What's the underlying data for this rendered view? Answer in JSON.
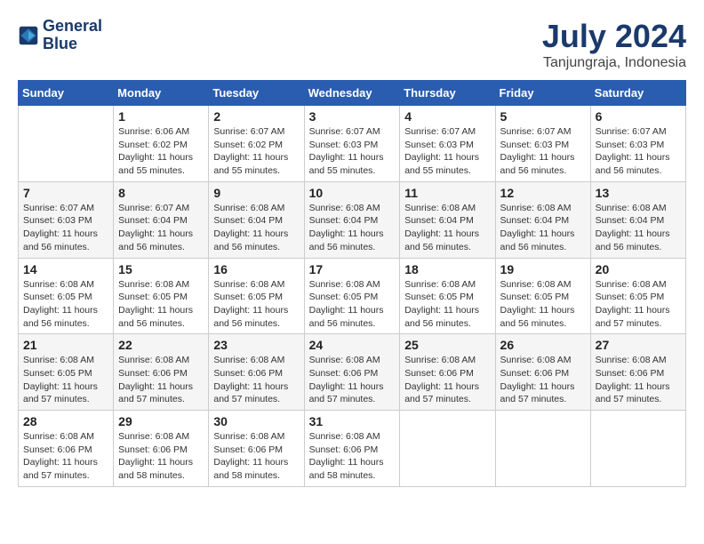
{
  "header": {
    "logo_line1": "General",
    "logo_line2": "Blue",
    "month_year": "July 2024",
    "location": "Tanjungraja, Indonesia"
  },
  "weekdays": [
    "Sunday",
    "Monday",
    "Tuesday",
    "Wednesday",
    "Thursday",
    "Friday",
    "Saturday"
  ],
  "weeks": [
    [
      {
        "day": "",
        "info": ""
      },
      {
        "day": "1",
        "info": "Sunrise: 6:06 AM\nSunset: 6:02 PM\nDaylight: 11 hours\nand 55 minutes."
      },
      {
        "day": "2",
        "info": "Sunrise: 6:07 AM\nSunset: 6:02 PM\nDaylight: 11 hours\nand 55 minutes."
      },
      {
        "day": "3",
        "info": "Sunrise: 6:07 AM\nSunset: 6:03 PM\nDaylight: 11 hours\nand 55 minutes."
      },
      {
        "day": "4",
        "info": "Sunrise: 6:07 AM\nSunset: 6:03 PM\nDaylight: 11 hours\nand 55 minutes."
      },
      {
        "day": "5",
        "info": "Sunrise: 6:07 AM\nSunset: 6:03 PM\nDaylight: 11 hours\nand 56 minutes."
      },
      {
        "day": "6",
        "info": "Sunrise: 6:07 AM\nSunset: 6:03 PM\nDaylight: 11 hours\nand 56 minutes."
      }
    ],
    [
      {
        "day": "7",
        "info": "Sunrise: 6:07 AM\nSunset: 6:03 PM\nDaylight: 11 hours\nand 56 minutes."
      },
      {
        "day": "8",
        "info": "Sunrise: 6:07 AM\nSunset: 6:04 PM\nDaylight: 11 hours\nand 56 minutes."
      },
      {
        "day": "9",
        "info": "Sunrise: 6:08 AM\nSunset: 6:04 PM\nDaylight: 11 hours\nand 56 minutes."
      },
      {
        "day": "10",
        "info": "Sunrise: 6:08 AM\nSunset: 6:04 PM\nDaylight: 11 hours\nand 56 minutes."
      },
      {
        "day": "11",
        "info": "Sunrise: 6:08 AM\nSunset: 6:04 PM\nDaylight: 11 hours\nand 56 minutes."
      },
      {
        "day": "12",
        "info": "Sunrise: 6:08 AM\nSunset: 6:04 PM\nDaylight: 11 hours\nand 56 minutes."
      },
      {
        "day": "13",
        "info": "Sunrise: 6:08 AM\nSunset: 6:04 PM\nDaylight: 11 hours\nand 56 minutes."
      }
    ],
    [
      {
        "day": "14",
        "info": "Sunrise: 6:08 AM\nSunset: 6:05 PM\nDaylight: 11 hours\nand 56 minutes."
      },
      {
        "day": "15",
        "info": "Sunrise: 6:08 AM\nSunset: 6:05 PM\nDaylight: 11 hours\nand 56 minutes."
      },
      {
        "day": "16",
        "info": "Sunrise: 6:08 AM\nSunset: 6:05 PM\nDaylight: 11 hours\nand 56 minutes."
      },
      {
        "day": "17",
        "info": "Sunrise: 6:08 AM\nSunset: 6:05 PM\nDaylight: 11 hours\nand 56 minutes."
      },
      {
        "day": "18",
        "info": "Sunrise: 6:08 AM\nSunset: 6:05 PM\nDaylight: 11 hours\nand 56 minutes."
      },
      {
        "day": "19",
        "info": "Sunrise: 6:08 AM\nSunset: 6:05 PM\nDaylight: 11 hours\nand 56 minutes."
      },
      {
        "day": "20",
        "info": "Sunrise: 6:08 AM\nSunset: 6:05 PM\nDaylight: 11 hours\nand 57 minutes."
      }
    ],
    [
      {
        "day": "21",
        "info": "Sunrise: 6:08 AM\nSunset: 6:05 PM\nDaylight: 11 hours\nand 57 minutes."
      },
      {
        "day": "22",
        "info": "Sunrise: 6:08 AM\nSunset: 6:06 PM\nDaylight: 11 hours\nand 57 minutes."
      },
      {
        "day": "23",
        "info": "Sunrise: 6:08 AM\nSunset: 6:06 PM\nDaylight: 11 hours\nand 57 minutes."
      },
      {
        "day": "24",
        "info": "Sunrise: 6:08 AM\nSunset: 6:06 PM\nDaylight: 11 hours\nand 57 minutes."
      },
      {
        "day": "25",
        "info": "Sunrise: 6:08 AM\nSunset: 6:06 PM\nDaylight: 11 hours\nand 57 minutes."
      },
      {
        "day": "26",
        "info": "Sunrise: 6:08 AM\nSunset: 6:06 PM\nDaylight: 11 hours\nand 57 minutes."
      },
      {
        "day": "27",
        "info": "Sunrise: 6:08 AM\nSunset: 6:06 PM\nDaylight: 11 hours\nand 57 minutes."
      }
    ],
    [
      {
        "day": "28",
        "info": "Sunrise: 6:08 AM\nSunset: 6:06 PM\nDaylight: 11 hours\nand 57 minutes."
      },
      {
        "day": "29",
        "info": "Sunrise: 6:08 AM\nSunset: 6:06 PM\nDaylight: 11 hours\nand 58 minutes."
      },
      {
        "day": "30",
        "info": "Sunrise: 6:08 AM\nSunset: 6:06 PM\nDaylight: 11 hours\nand 58 minutes."
      },
      {
        "day": "31",
        "info": "Sunrise: 6:08 AM\nSunset: 6:06 PM\nDaylight: 11 hours\nand 58 minutes."
      },
      {
        "day": "",
        "info": ""
      },
      {
        "day": "",
        "info": ""
      },
      {
        "day": "",
        "info": ""
      }
    ]
  ]
}
